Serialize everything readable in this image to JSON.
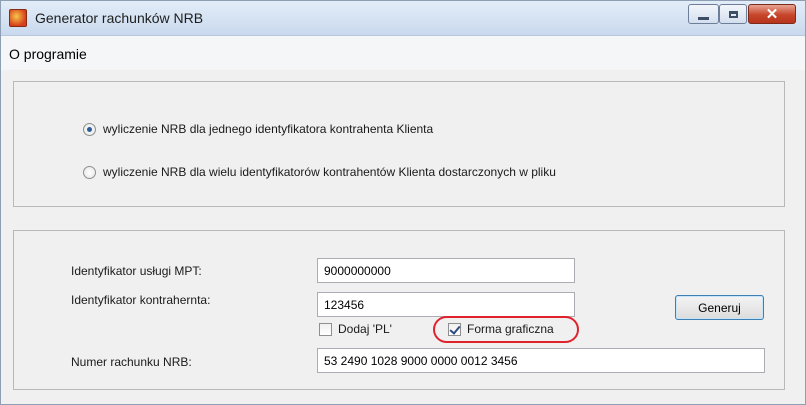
{
  "window": {
    "title": "Generator rachunków NRB",
    "close_glyph": "✕"
  },
  "menu": {
    "items": [
      {
        "label": "O programie"
      }
    ]
  },
  "mode": {
    "options": [
      {
        "label": "wyliczenie NRB dla jednego identyfikatora kontrahenta Klienta",
        "selected": true
      },
      {
        "label": "wyliczenie NRB dla wielu identyfikatorów kontrahentów Klienta dostarczonych w pliku",
        "selected": false
      }
    ]
  },
  "form": {
    "service_id": {
      "label": "Identyfikator usługi MPT:",
      "value": "9000000000"
    },
    "contractor_id": {
      "label": "Identyfikator kontrahernta:",
      "value": "123456"
    },
    "add_pl": {
      "label": "Dodaj 'PL'",
      "checked": false
    },
    "graphic_form": {
      "label": "Forma graficzna",
      "checked": true
    },
    "nrb": {
      "label": "Numer rachunku NRB:",
      "value": "53 2490 1028 9000 0000 0012 3456"
    },
    "generate_label": "Generuj"
  },
  "colors": {
    "highlight": "#e0222d",
    "close_button": "#c7452a"
  },
  "icons": {
    "app": "app-icon",
    "minimize": "minimize-icon",
    "maximize": "maximize-icon",
    "close": "close-icon"
  }
}
